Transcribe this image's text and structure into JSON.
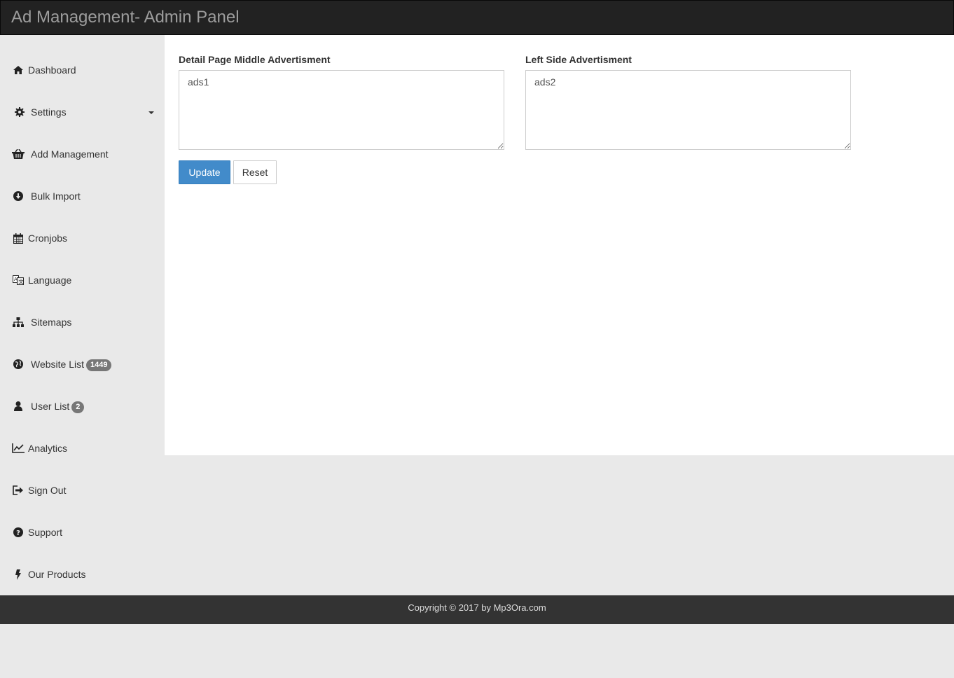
{
  "header": {
    "title": "Ad Management- Admin Panel"
  },
  "sidebar": {
    "items": [
      {
        "label": "Dashboard",
        "icon": "home-icon"
      },
      {
        "label": "Settings",
        "icon": "gear-icon"
      },
      {
        "label": "Add Management",
        "icon": "basket-icon"
      },
      {
        "label": "Bulk Import",
        "icon": "download-circle-icon"
      },
      {
        "label": "Cronjobs",
        "icon": "calendar-icon"
      },
      {
        "label": "Language",
        "icon": "language-icon"
      },
      {
        "label": "Sitemaps",
        "icon": "sitemap-icon"
      },
      {
        "label": "Website List",
        "icon": "globe-icon",
        "badge": "1449"
      },
      {
        "label": "User List",
        "icon": "user-icon",
        "badge": "2"
      },
      {
        "label": "Analytics",
        "icon": "line-chart-icon"
      },
      {
        "label": "Sign Out",
        "icon": "sign-out-icon"
      },
      {
        "label": "Support",
        "icon": "question-circle-icon"
      },
      {
        "label": "Our Products",
        "icon": "bolt-icon"
      }
    ]
  },
  "form": {
    "middle_ad": {
      "label": "Detail Page Middle Advertisment",
      "value": "ads1"
    },
    "left_ad": {
      "label": "Left Side Advertisment",
      "value": "ads2"
    },
    "update_label": "Update",
    "reset_label": "Reset"
  },
  "footer": {
    "text": "Copyright © 2017 by Mp3Ora.com"
  },
  "colors": {
    "topbar": "#222222",
    "primary": "#428bca",
    "sidebar_bg": "#e9e9e9",
    "footer_bg": "#333333"
  }
}
